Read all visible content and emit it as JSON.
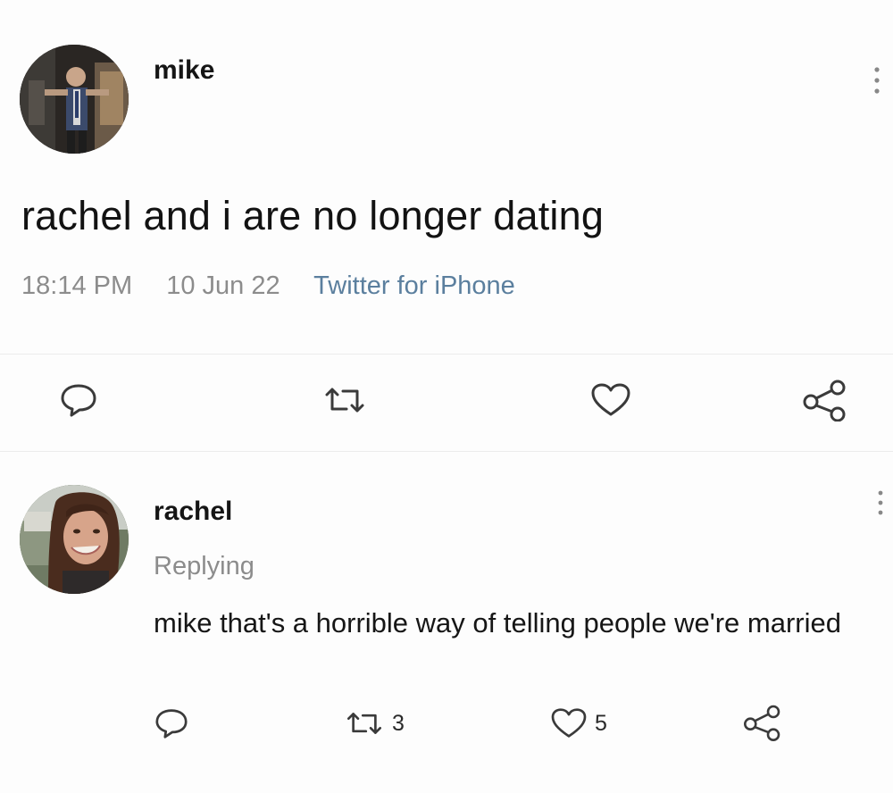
{
  "main_tweet": {
    "author": "mike",
    "text": "rachel and i are no longer dating",
    "time": "18:14 PM",
    "date": "10 Jun 22",
    "source": "Twitter for iPhone",
    "actions": {
      "reply_icon": "speech-bubble-icon",
      "retweet_icon": "retweet-icon",
      "like_icon": "heart-icon",
      "share_icon": "share-icon"
    }
  },
  "reply": {
    "author": "rachel",
    "replying_label": "Replying",
    "text": "mike that's a horrible way of telling people we're married",
    "retweet_count": "3",
    "like_count": "5",
    "actions": {
      "reply_icon": "speech-bubble-icon",
      "retweet_icon": "retweet-icon",
      "like_icon": "heart-icon",
      "share_icon": "share-icon"
    }
  },
  "colors": {
    "background": "#fdfdfd",
    "text": "#121212",
    "muted": "#8c8c8c",
    "source_link": "#5b7f9e"
  }
}
